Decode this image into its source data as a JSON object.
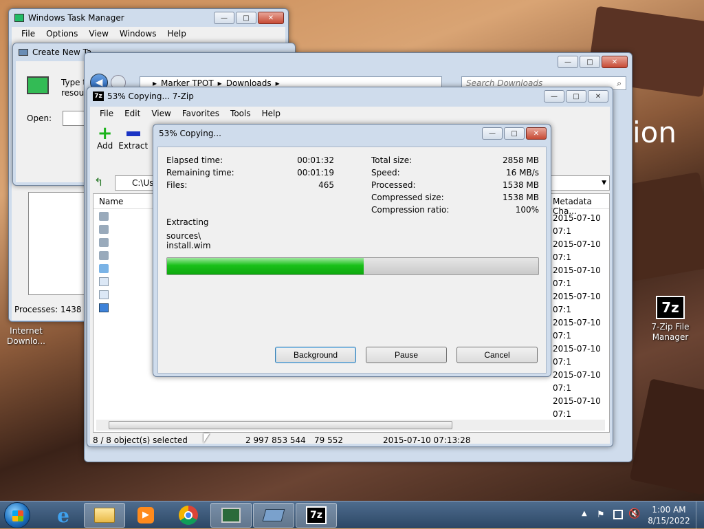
{
  "desktop": {
    "partial_text": "ion",
    "icons": [
      {
        "label_line1": "Internet",
        "label_line2": "Downlo..."
      },
      {
        "label_line1": "7-Zip File",
        "label_line2": "Manager",
        "badge": "7z"
      }
    ]
  },
  "task_manager": {
    "title": "Windows Task Manager",
    "menu": [
      "File",
      "Options",
      "View",
      "Windows",
      "Help"
    ],
    "processes": "Processes: 1438"
  },
  "create_task": {
    "title": "Create New Ta",
    "type_text": "Type t",
    "resource_text": "resour",
    "open_label": "Open:"
  },
  "explorer": {
    "path": [
      "Marker TPOT",
      "Downloads"
    ],
    "search_placeholder": "Search Downloads"
  },
  "sevenzip": {
    "title": "53% Copying... 7-Zip",
    "menu": [
      "File",
      "Edit",
      "View",
      "Favorites",
      "Tools",
      "Help"
    ],
    "toolbar": {
      "add": "Add",
      "extract": "Extract"
    },
    "path": "C:\\Use",
    "col_name": "Name",
    "col_meta": "Metadata Cha...",
    "meta_values": [
      "2015-07-10 07:1",
      "2015-07-10 07:1",
      "2015-07-10 07:1",
      "2015-07-10 07:1",
      "2015-07-10 07:1",
      "2015-07-10 07:1",
      "2015-07-10 07:1",
      "2015-07-10 07:1"
    ],
    "status": {
      "selected": "8 / 8 object(s) selected",
      "size": "2 997 853 544",
      "packed": "79 552",
      "date": "2015-07-10 07:13:28"
    }
  },
  "copy_dialog": {
    "title": "53% Copying...",
    "progress": 0.53,
    "left_labels": [
      "Elapsed time:",
      "Remaining time:",
      "Files:"
    ],
    "left_values": [
      "00:01:32",
      "00:01:19",
      "465"
    ],
    "right_labels": [
      "Total size:",
      "Speed:",
      "Processed:",
      "Compressed size:",
      "Compression ratio:"
    ],
    "right_values": [
      "2858 MB",
      "16 MB/s",
      "1538 MB",
      "1538 MB",
      "100%"
    ],
    "extracting_label": "Extracting",
    "file_dir": "sources\\",
    "file_name": "install.wim",
    "buttons": {
      "background": "Background",
      "pause": "Pause",
      "cancel": "Cancel"
    }
  },
  "taskbar": {
    "time": "1:00 AM",
    "date": "8/15/2022",
    "zip_label": "7z"
  }
}
